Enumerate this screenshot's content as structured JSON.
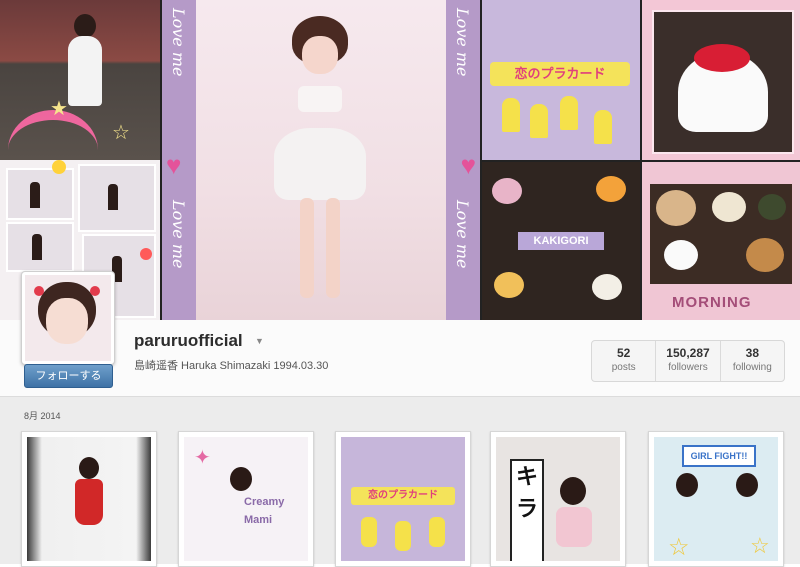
{
  "header": {
    "collage_texts": {
      "love_me": "Love me",
      "placard": "恋のプラカード",
      "kakigori": "KAKIGORI",
      "morning": "MORNING"
    }
  },
  "profile": {
    "username": "paruruofficial",
    "bio": "島崎遥香  Haruka Shimazaki 1994.03.30",
    "follow_label": "フォローする",
    "stats": [
      {
        "num": "52",
        "label": "posts"
      },
      {
        "num": "150,287",
        "label": "followers"
      },
      {
        "num": "38",
        "label": "following"
      }
    ]
  },
  "feed": {
    "month_label": "8月 2014",
    "thumb_texts": {
      "creamy": "Creamy",
      "mami": "Mami",
      "placard": "恋のプラカード",
      "kira": "キラ",
      "girl_fight": "GIRL FIGHT!!"
    }
  },
  "colors": {
    "accent_button": "#3e72a6",
    "lilac_band": "#b59ac8",
    "pink_heart": "#e4539a"
  }
}
